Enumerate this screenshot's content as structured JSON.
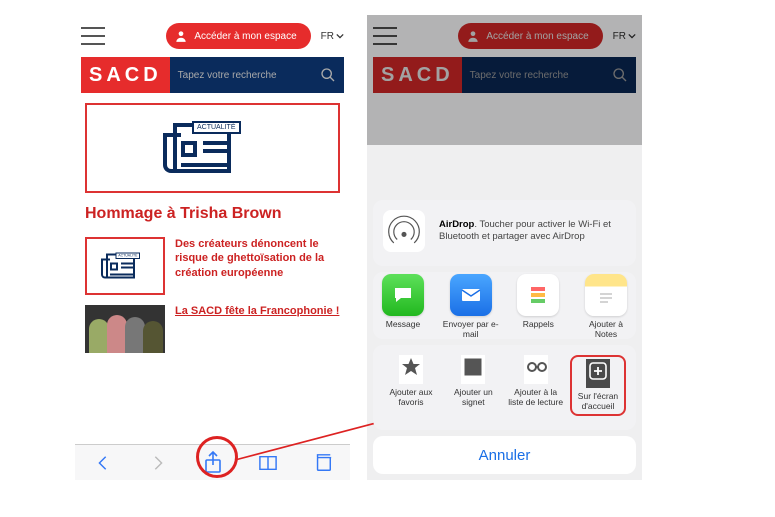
{
  "header": {
    "login_label": "Accéder à mon espace",
    "lang": "FR",
    "logo": "SACD",
    "search_placeholder": "Tapez votre recherche"
  },
  "left": {
    "hero_tag": "ACTUALITÉ",
    "headline": "Hommage à Trisha Brown",
    "story2": "Des créateurs dénoncent le risque de ghettoïsation de la création européenne",
    "story3": "La SACD fête la Francophonie !"
  },
  "sheet": {
    "airdrop_bold": "AirDrop",
    "airdrop_text": ". Toucher pour activer le Wi-Fi et Bluetooth et partager avec AirDrop",
    "apps": {
      "message": "Message",
      "mail": "Envoyer par e-mail",
      "reminders": "Rappels",
      "notes": "Ajouter à Notes"
    },
    "actions": {
      "favorites": "Ajouter aux favoris",
      "bookmark": "Ajouter un signet",
      "readinglist": "Ajouter à la liste de lecture",
      "homescreen": "Sur l'écran d'accueil"
    },
    "cancel": "Annuler"
  }
}
